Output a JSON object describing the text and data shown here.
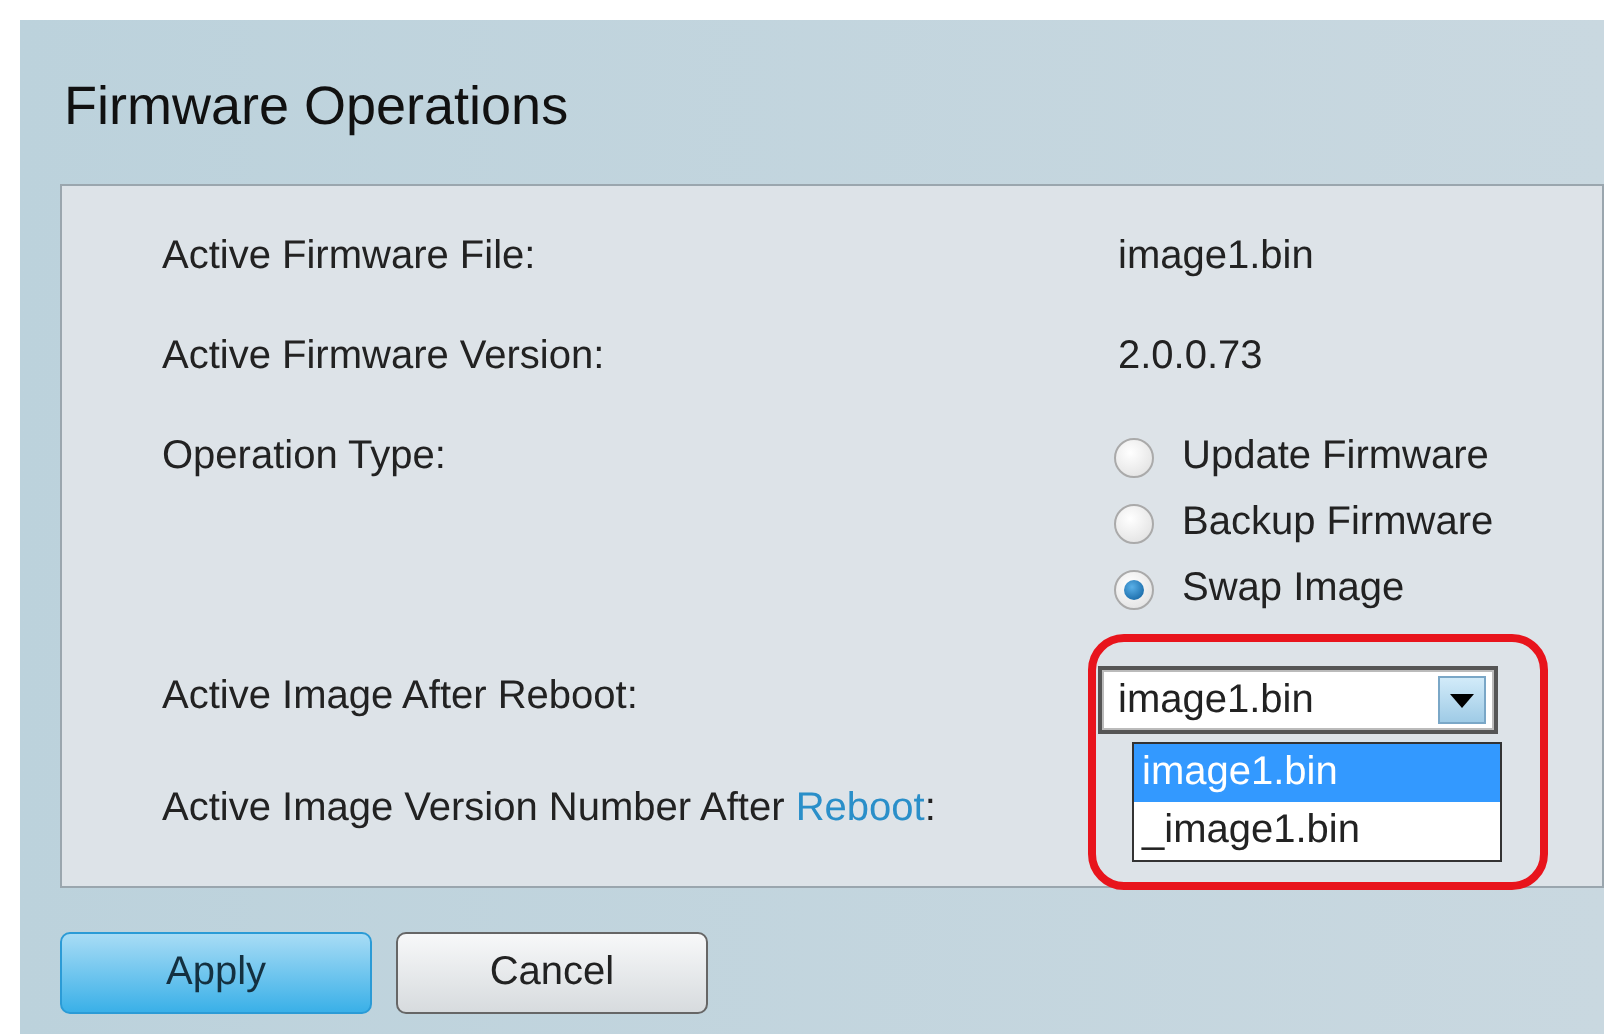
{
  "title": "Firmware Operations",
  "rows": [
    {
      "kind": "text",
      "label": "Active Firmware File:",
      "value": "image1.bin"
    },
    {
      "kind": "text",
      "label": "Active Firmware Version:",
      "value": "2.0.0.73"
    },
    {
      "kind": "radio",
      "label": "Operation Type:",
      "options": [
        {
          "label": "Update Firmware",
          "selected": false
        },
        {
          "label": "Backup Firmware",
          "selected": false
        },
        {
          "label": "Swap Image",
          "selected": true
        }
      ]
    },
    {
      "kind": "select",
      "label": "Active Image After Reboot:",
      "value": "image1.bin",
      "expanded": true,
      "highlighted": true,
      "options": [
        {
          "label": "image1.bin",
          "selected": true
        },
        {
          "label": "_image1.bin",
          "selected": false
        }
      ]
    },
    {
      "kind": "link",
      "label": "Active Image Version Number After ",
      "link": "Reboot",
      "suffix": ":"
    }
  ],
  "buttons": [
    {
      "label": "Apply",
      "primary": true
    },
    {
      "label": "Cancel",
      "primary": false
    }
  ]
}
